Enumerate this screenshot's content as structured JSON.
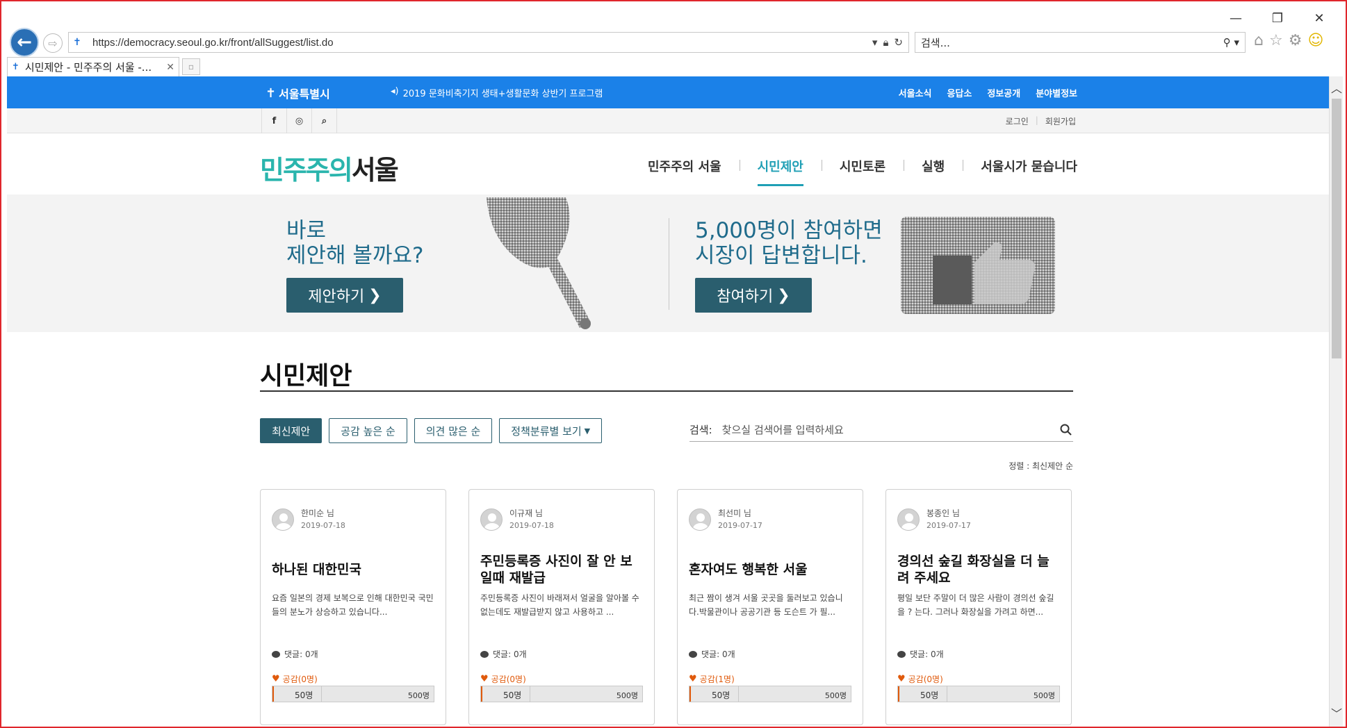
{
  "browser": {
    "url": "https://democracy.seoul.go.kr/front/allSuggest/list.do",
    "search_placeholder": "검색...",
    "tab_title": "시민제안 - 민주주의 서울 -...",
    "window_controls": [
      "—",
      "❐",
      "✕"
    ]
  },
  "topbar": {
    "city_logo": "서울특별시",
    "notice": "2019 문화비축기지 생태+생활문화 상반기 프로그램",
    "links": [
      "서울소식",
      "응답소",
      "정보공개",
      "분야별정보"
    ]
  },
  "utilbar": {
    "social": [
      "f",
      "◎",
      "⌕"
    ],
    "login": "로그인",
    "signup": "회원가입"
  },
  "header": {
    "logo_part1": "민주주의",
    "logo_part2": "서울",
    "nav": [
      "민주주의 서울",
      "시민제안",
      "시민토론",
      "실행",
      "서울시가 묻습니다"
    ]
  },
  "banner": {
    "left_line1": "바로",
    "left_line2": "제안해 볼까요?",
    "left_button": "제안하기",
    "right_line1": "5,000명이 참여하면",
    "right_line2": "시장이 답변합니다.",
    "right_button": "참여하기"
  },
  "section": {
    "title": "시민제안",
    "filters": [
      "최신제안",
      "공감 높은 순",
      "의견 많은 순",
      "정책분류별 보기"
    ],
    "search_label": "검색:",
    "search_placeholder": "찾으실 검색어를 입력하세요",
    "sort": "정렬 : 최신제안 순"
  },
  "cards": [
    {
      "author": "한미순 님",
      "date": "2019-07-18",
      "title": "하나된 대한민국",
      "body": "요즘 일본의 경제 보복으로 인해 대한민국 국민들의 분노가 상승하고 있습니다...",
      "comments": "댓글: 0개",
      "likes": "공감(0명)",
      "progress_min": "50명",
      "progress_max": "500명",
      "progress_fraction": 0.0
    },
    {
      "author": "이규재 님",
      "date": "2019-07-18",
      "title": "주민등록증 사진이 잘 안 보일때 재발급",
      "body": "주민등록증 사진이 바래져서 얼굴을 알아볼 수 없는데도 재발급받지 않고 사용하고 ...",
      "comments": "댓글: 0개",
      "likes": "공감(0명)",
      "progress_min": "50명",
      "progress_max": "500명",
      "progress_fraction": 0.0
    },
    {
      "author": "최선미 님",
      "date": "2019-07-17",
      "title": "혼자여도 행복한 서울",
      "body": "최근 짬이 생겨 서울 곳곳을 둘러보고 있습니다.박물관이나 공공기관 등 도슨트 가 필...",
      "comments": "댓글: 0개",
      "likes": "공감(1명)",
      "progress_min": "50명",
      "progress_max": "500명",
      "progress_fraction": 0.002
    },
    {
      "author": "봉종인 님",
      "date": "2019-07-17",
      "title": "경의선 숲길 화장실을 더 늘려 주세요",
      "body": "평일 보단 주말이 더 많은 사람이 경의선 숲길을 ? 는다. 그러나 화장실을 가려고 하면...",
      "comments": "댓글: 0개",
      "likes": "공감(0명)",
      "progress_min": "50명",
      "progress_max": "500명",
      "progress_fraction": 0.0
    }
  ],
  "colors": {
    "topbar": "#1b81e8",
    "logo_accent": "#2ab5ad",
    "button_teal": "#2a5e6e",
    "active_nav": "#1f9fb5",
    "like_orange": "#e05a0c"
  }
}
